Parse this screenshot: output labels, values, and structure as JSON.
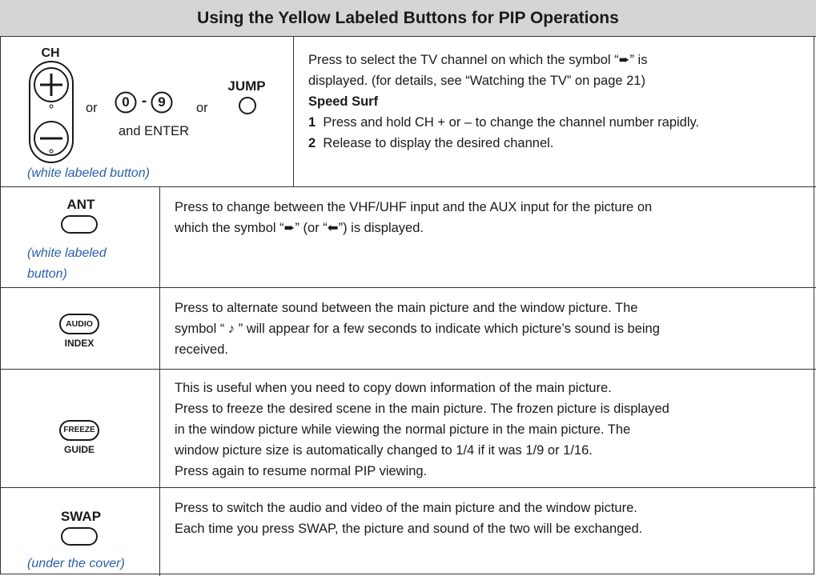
{
  "title": "Using the Yellow Labeled Buttons for PIP Operations",
  "rows": [
    {
      "button": {
        "top_label": "CH",
        "plus": "+",
        "minus": "–",
        "or1": "or",
        "digit_first": "0",
        "dash": "-",
        "digit_last": "9",
        "or2": "or",
        "jump_label": "JUMP",
        "enter": "and ENTER"
      },
      "note": "(white labeled button)",
      "lines": [
        "Press to select the TV channel on which the symbol “➨” is",
        "displayed. (for details, see “Watching the TV” on page 21)"
      ],
      "subheading": "Speed Surf",
      "steps": [
        {
          "num": "1",
          "text": "Press and hold CH + or – to change the channel number rapidly."
        },
        {
          "num": "2",
          "text": "Release to display the desired channel."
        }
      ]
    },
    {
      "button": {
        "top_label": "ANT"
      },
      "note_lines": [
        "(white labeled",
        "button)"
      ],
      "lines": [
        "Press to change between the VHF/UHF input and the AUX input for the picture on",
        "which the symbol “➨” (or “⬅”) is displayed."
      ]
    },
    {
      "button": {
        "face": "AUDIO",
        "below": "INDEX"
      },
      "lines": [
        "Press to alternate sound between the main picture and the window picture. The",
        "symbol “ ♪ ” will appear for a few seconds to indicate which picture’s sound is being",
        "received."
      ]
    },
    {
      "button": {
        "face": "FREEZE",
        "below": "GUIDE"
      },
      "lines": [
        "This is useful when you need to copy down information of the main picture.",
        "Press to freeze the desired scene in the main picture. The frozen picture is displayed",
        "in the window picture while viewing the normal picture in the main picture.  The",
        "window picture size is automatically changed to 1/4 if it was 1/9 or 1/16.",
        "Press again to resume normal PIP viewing."
      ]
    },
    {
      "button": {
        "top_label": "SWAP"
      },
      "note": "(under the cover)",
      "lines": [
        "Press to switch the audio and video of the main picture and the window picture.",
        "Each time you press SWAP, the picture and sound of the two will be exchanged."
      ]
    }
  ]
}
